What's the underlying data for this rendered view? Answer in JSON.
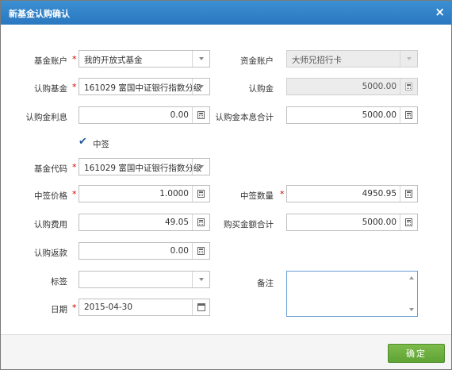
{
  "dialog": {
    "title": "新基金认购确认",
    "close": "×"
  },
  "form": {
    "fund_account": {
      "label": "基金账户",
      "value": "我的开放式基金"
    },
    "cash_account": {
      "label": "资金账户",
      "value": "大师兄招行卡"
    },
    "subscribe_fund": {
      "label": "认购基金",
      "value": "161029 富国中证银行指数分级"
    },
    "subscribe_amount": {
      "label": "认购金",
      "value": "5000.00"
    },
    "subscribe_interest": {
      "label": "认购金利息",
      "value": "0.00"
    },
    "principal_interest_total": {
      "label": "认购金本息合计",
      "value": "5000.00"
    },
    "won_lottery": {
      "label": "中签",
      "checked": true
    },
    "fund_code": {
      "label": "基金代码",
      "value": "161029 富国中证银行指数分级"
    },
    "won_price": {
      "label": "中签价格",
      "value": "1.0000"
    },
    "won_quantity": {
      "label": "中签数量",
      "value": "4950.95"
    },
    "subscribe_fee": {
      "label": "认购费用",
      "value": "49.05"
    },
    "purchase_total": {
      "label": "购买金额合计",
      "value": "5000.00"
    },
    "subscribe_refund": {
      "label": "认购返款",
      "value": "0.00"
    },
    "tag": {
      "label": "标签",
      "value": ""
    },
    "remark": {
      "label": "备注",
      "value": ""
    },
    "date": {
      "label": "日期",
      "value": "2015-04-30"
    }
  },
  "required_mark": "*",
  "footer": {
    "ok_label": "确定"
  },
  "colors": {
    "title_bar": "#2a78c0",
    "ok_button": "#5fa336",
    "required": "#d40000"
  }
}
